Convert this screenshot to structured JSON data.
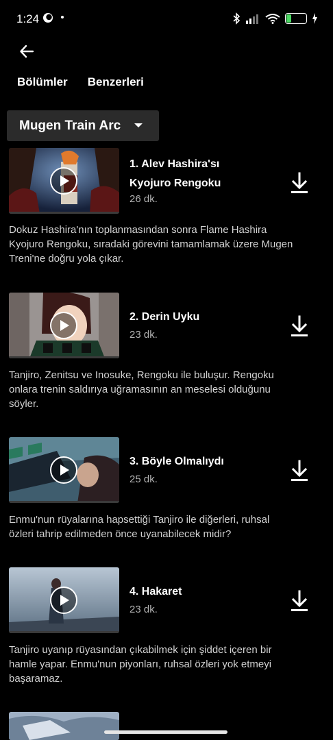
{
  "status_bar": {
    "time": "1:24",
    "battery": "19"
  },
  "header": {
    "back_icon": "arrow-left-icon",
    "tabs": [
      "Bölümler",
      "Benzerleri"
    ]
  },
  "season_selector": {
    "selected": "Mugen Train Arc",
    "icon": "caret-down-icon"
  },
  "episodes": [
    {
      "title": "1. Alev Hashira'sı Kyojuro Rengoku",
      "duration": "26 dk.",
      "description": "Dokuz Hashira'nın toplanmasından sonra Flame Hashira Kyojuro Rengoku, sıradaki görevini tamamlamak üzere Mugen Treni'ne doğru yola çıkar."
    },
    {
      "title": "2. Derin Uyku",
      "duration": "23 dk.",
      "description": "Tanjiro, Zenitsu ve Inosuke, Rengoku ile buluşur. Rengoku onlara trenin saldırıya uğramasının an meselesi olduğunu söyler."
    },
    {
      "title": "3. Böyle Olmalıydı",
      "duration": "25 dk.",
      "description": "Enmu'nun rüyalarına hapsettiği Tanjiro ile diğerleri, ruhsal özleri tahrip edilmeden önce uyanabilecek midir?"
    },
    {
      "title": "4. Hakaret",
      "duration": "23 dk.",
      "description": "Tanjiro uyanıp rüyasından çıkabilmek için şiddet içeren bir hamle yapar. Enmu'nun piyonları, ruhsal özleri yok etmeyi başaramaz."
    }
  ],
  "colors": {
    "background": "#000000",
    "selector_bg": "#2b2b2b",
    "secondary_text": "#b3b3b3",
    "battery_fill": "#4cd964"
  }
}
